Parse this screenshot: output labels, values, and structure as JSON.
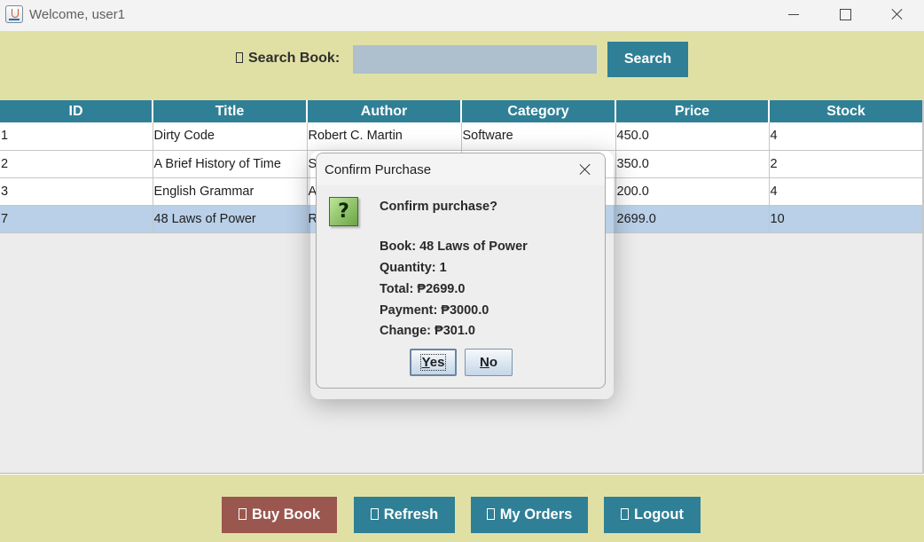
{
  "window": {
    "title": "Welcome, user1"
  },
  "search": {
    "label": "Search Book:",
    "value": "",
    "placeholder": "",
    "button_label": "Search"
  },
  "table": {
    "columns": [
      "ID",
      "Title",
      "Author",
      "Category",
      "Price",
      "Stock"
    ],
    "rows": [
      [
        "1",
        "Dirty Code",
        "Robert C. Martin",
        "Software",
        "450.0",
        "4"
      ],
      [
        "2",
        "A Brief History of Time",
        "S",
        "",
        "350.0",
        "2"
      ],
      [
        "3",
        "English Grammar",
        "A",
        "",
        "200.0",
        "4"
      ],
      [
        "7",
        "48 Laws of Power",
        "R",
        "",
        "2699.0",
        "10"
      ]
    ],
    "selected_row": 3
  },
  "dialog": {
    "title": "Confirm Purchase",
    "heading": "Confirm purchase?",
    "book_line": "Book: 48 Laws of Power",
    "quantity_line": "Quantity: 1",
    "total_line": "Total: ₱2699.0",
    "payment_line": "Payment: ₱3000.0",
    "change_line": "Change: ₱301.0",
    "yes_mnemonic": "Y",
    "yes_rest": "es",
    "no_mnemonic": "N",
    "no_rest": "o",
    "icon": "question-icon"
  },
  "actions": {
    "buy_label": "Buy Book",
    "refresh_label": "Refresh",
    "orders_label": "My Orders",
    "logout_label": "Logout"
  },
  "colors": {
    "panel_bg": "#e1e0a4",
    "accent_teal": "#2f8096",
    "buy_button": "#9a574f",
    "selected_row": "#b9d0e8",
    "search_field": "#aebfcd"
  }
}
